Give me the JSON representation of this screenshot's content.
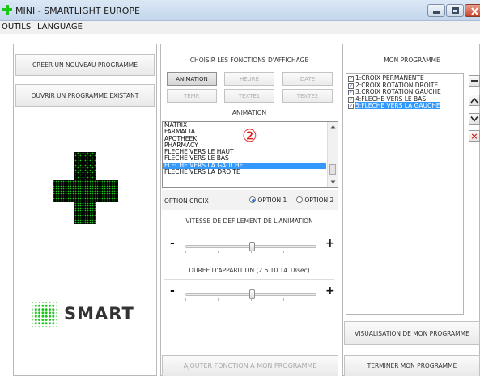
{
  "window": {
    "title": "MINI  - SMARTLIGHT EUROPE"
  },
  "menu": {
    "items": [
      "OUTILS",
      "LANGUAGE"
    ]
  },
  "left_panel": {
    "create_program": "CREER UN NOUVEAU PROGRAMME",
    "open_program": "OUVRIR UN PROGRAMME EXISTANT",
    "logo_text": "SMART"
  },
  "center_panel": {
    "heading": "CHOISIR LES FONCTIONS D'AFFICHAGE",
    "functions": [
      {
        "label": "ANIMATION",
        "active": true
      },
      {
        "label": "HEURE",
        "active": false
      },
      {
        "label": "DATE",
        "active": false
      },
      {
        "label": "TEMP.",
        "active": false
      },
      {
        "label": "TEXTE1",
        "active": false
      },
      {
        "label": "TEXTE2",
        "active": false
      }
    ],
    "section_label": "ANIMATION",
    "animation_list": [
      "MATRIX",
      "FARMACIA",
      "APOTHEEK",
      "PHARMACY",
      "FLECHE VERS LE HAUT",
      "FLECHE VERS LE BAS",
      "FLECHE VERS LA GAUCHE",
      "FLECHE VERS LA DROITE"
    ],
    "selected_animation": "FLECHE VERS LA GAUCHE",
    "marker": "②",
    "option_label": "OPTION CROIX",
    "option1": "OPTION 1",
    "option2": "OPTION 2",
    "speed_label": "VITESSE DE DEFILEMENT DE L'ANIMATION",
    "duration_label": "DUREE D'APPARITION (2 6 10 14 18sec)",
    "minus": "-",
    "plus": "+",
    "add_button": "AJOUTER FONCTION A MON PROGRAMME"
  },
  "right_panel": {
    "heading": "MON PROGRAMME",
    "program_items": [
      "1:CROIX PERMANENTE",
      "2:CROIX ROTATION DROITE",
      "3:CROIX ROTATION GAUCHE",
      "4:FLECHE VERS LE BAS",
      "5:FLECHE VERS LA GAUCHE"
    ],
    "selected_item": "5:FLECHE VERS LA GAUCHE",
    "visualize_button": "VISUALISATION DE MON PROGRAMME",
    "finish_button": "TERMINER MON PROGRAMME",
    "delete_symbol": "×"
  },
  "colors": {
    "led_green": "#19c719",
    "led_dim": "#0c3d0c",
    "selection_blue": "#3399ff",
    "delete_red": "#d81c1c"
  },
  "icons": [
    "app-cross-icon",
    "minimize-icon",
    "maximize-icon",
    "close-icon",
    "up-arrow-icon",
    "down-arrow-icon",
    "delete-icon",
    "led-cross-icon"
  ]
}
